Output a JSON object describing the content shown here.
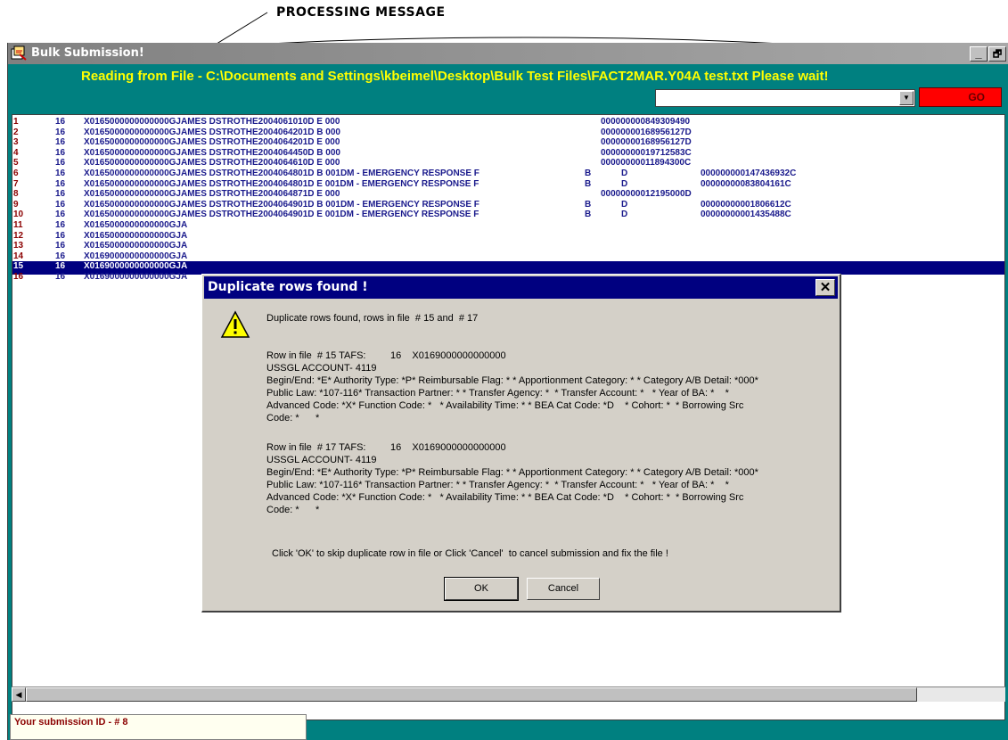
{
  "annotation": {
    "label": "PROCESSING MESSAGE"
  },
  "window": {
    "title": "Bulk Submission!",
    "minimize_glyph": "_",
    "restore_glyph": "🗗",
    "reading_message": "Reading from File - C:\\Documents and Settings\\kbeimel\\Desktop\\Bulk Test Files\\FACT2MAR.Y04A test.txt Please wait!",
    "go_label": "GO",
    "status_text": "Your submission ID - # 8"
  },
  "rows": [
    {
      "idx": "1",
      "grp": "16",
      "text": "X0165000000000000GJAMES DSTROTHE2004061010D E 000",
      "amount": "000000000849309490"
    },
    {
      "idx": "2",
      "grp": "16",
      "text": "X0165000000000000GJAMES DSTROTHE2004064201D B 000",
      "amount": "00000000168956127D"
    },
    {
      "idx": "3",
      "grp": "16",
      "text": "X0165000000000000GJAMES DSTROTHE2004064201D E 000",
      "amount": "00000000168956127D"
    },
    {
      "idx": "4",
      "grp": "16",
      "text": "X0165000000000000GJAMES DSTROTHE2004064450D B 000",
      "amount": "00000000019712583C"
    },
    {
      "idx": "5",
      "grp": "16",
      "text": "X0165000000000000GJAMES DSTROTHE2004064610D E 000",
      "amount": "00000000011894300C"
    },
    {
      "idx": "6",
      "grp": "16",
      "text": "X0165000000000000GJAMES DSTROTHE2004064801D B 001DM - EMERGENCY RESPONSE F",
      "cols": [
        "B",
        "D"
      ],
      "amount": "000000000147436932C"
    },
    {
      "idx": "7",
      "grp": "16",
      "text": "X0165000000000000GJAMES DSTROTHE2004064801D E 001DM - EMERGENCY RESPONSE F",
      "cols": [
        "B",
        "D"
      ],
      "amount": "00000000083804161C"
    },
    {
      "idx": "8",
      "grp": "16",
      "text": "X0165000000000000GJAMES DSTROTHE2004064871D E 000",
      "amount": "00000000012195000D"
    },
    {
      "idx": "9",
      "grp": "16",
      "text": "X0165000000000000GJAMES DSTROTHE2004064901D B 001DM - EMERGENCY RESPONSE F",
      "cols": [
        "B",
        "D"
      ],
      "amount": "00000000001806612C"
    },
    {
      "idx": "10",
      "grp": "16",
      "text": "X0165000000000000GJAMES DSTROTHE2004064901D E 001DM - EMERGENCY RESPONSE F",
      "cols": [
        "B",
        "D"
      ],
      "amount": "00000000001435488C"
    },
    {
      "idx": "11",
      "grp": "16",
      "text": "X0165000000000000GJA"
    },
    {
      "idx": "12",
      "grp": "16",
      "text": "X0165000000000000GJA"
    },
    {
      "idx": "13",
      "grp": "16",
      "text": "X0165000000000000GJA"
    },
    {
      "idx": "14",
      "grp": "16",
      "text": "X0169000000000000GJA"
    },
    {
      "idx": "15",
      "grp": "16",
      "text": "X0169000000000000GJA",
      "selected": true
    },
    {
      "idx": "16",
      "grp": "16",
      "text": "X0169000000000000GJA"
    }
  ],
  "dialog": {
    "title": "Duplicate rows found !",
    "close_glyph": "✕",
    "summary": "Duplicate rows found, rows in file  # 15 and  # 17",
    "block1": "Row in file  # 15 TAFS:         16    X0169000000000000\nUSSGL ACCOUNT- 4119\nBegin/End: *E* Authority Type: *P* Reimbursable Flag: * * Apportionment Category: * * Category A/B Detail: *000*\nPublic Law: *107-116* Transaction Partner: * * Transfer Agency: *  * Transfer Account: *   * Year of BA: *    *\nAdvanced Code: *X* Function Code: *   * Availability Time: * * BEA Cat Code: *D    * Cohort: *  * Borrowing Src\nCode: *      *",
    "block2": "Row in file  # 17 TAFS:         16    X0169000000000000\nUSSGL ACCOUNT- 4119\nBegin/End: *E* Authority Type: *P* Reimbursable Flag: * * Apportionment Category: * * Category A/B Detail: *000*\nPublic Law: *107-116* Transaction Partner: * * Transfer Agency: *  * Transfer Account: *   * Year of BA: *    *\nAdvanced Code: *X* Function Code: *   * Availability Time: * * BEA Cat Code: *D    * Cohort: *  * Borrowing Src\nCode: *      *",
    "instruction": "Click 'OK' to skip duplicate row in file or Click 'Cancel'  to cancel submission and fix the file !",
    "ok_label": "OK",
    "cancel_label": "Cancel"
  }
}
